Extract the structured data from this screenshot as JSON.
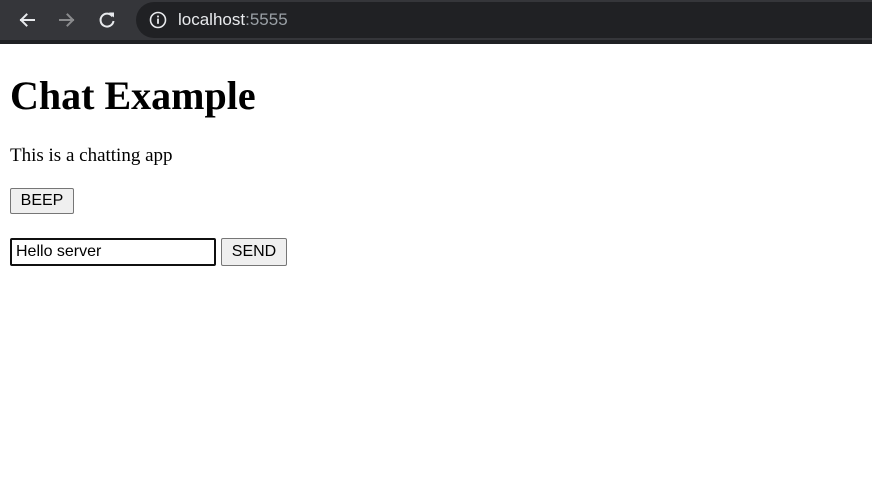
{
  "browser": {
    "url_host": "localhost",
    "url_port": ":5555",
    "icons": {
      "back": "arrow-left-icon",
      "forward": "arrow-right-icon",
      "reload": "reload-icon",
      "info": "info-icon"
    }
  },
  "page": {
    "title": "Chat Example",
    "description": "This is a chatting app",
    "beep_label": "BEEP",
    "message_value": "Hello server",
    "send_label": "SEND"
  }
}
